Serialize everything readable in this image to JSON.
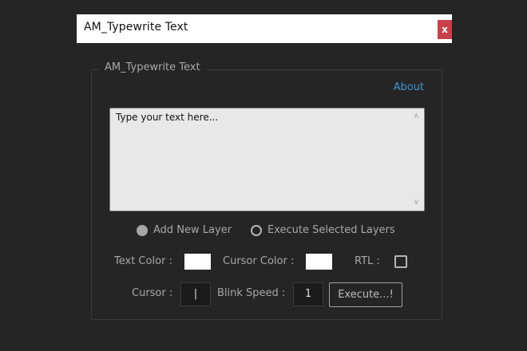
{
  "window": {
    "title": "AM_Typewrite Text",
    "close_label": "x"
  },
  "panel": {
    "group_title": "AM_Typewrite Text",
    "about_label": "About"
  },
  "text_input": {
    "placeholder": "Type your text here..."
  },
  "mode": {
    "add_new_layer_label": "Add New Layer",
    "add_new_layer_selected": true,
    "execute_selected_label": "Execute Selected Layers",
    "execute_selected_selected": false
  },
  "options": {
    "text_color_label": "Text Color :",
    "text_color": "#ffffff",
    "cursor_color_label": "Cursor Color :",
    "cursor_color": "#ffffff",
    "rtl_label": "RTL :",
    "rtl_checked": false,
    "cursor_label": "Cursor :",
    "cursor_value": "|",
    "blink_speed_label": "Blink Speed :",
    "blink_speed_value": "1",
    "execute_label": "Execute...!"
  },
  "colors": {
    "link": "#3d93d3",
    "close_button": "#c8404b",
    "panel_background": "#252525"
  }
}
